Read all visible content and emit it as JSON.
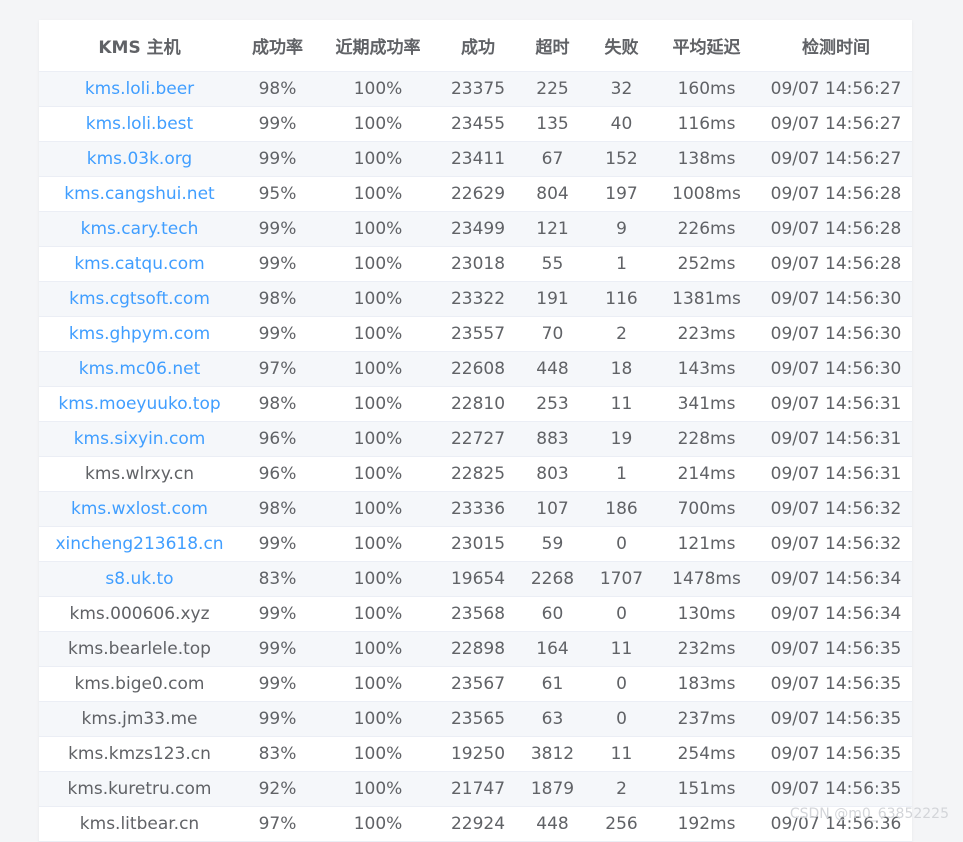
{
  "table": {
    "headers": [
      "KMS 主机",
      "成功率",
      "近期成功率",
      "成功",
      "超时",
      "失败",
      "平均延迟",
      "检测时间"
    ],
    "rows": [
      {
        "host": "kms.loli.beer",
        "link": true,
        "rate": "98%",
        "recent": "100%",
        "success": "23375",
        "timeout": "225",
        "fail": "32",
        "latency": "160ms",
        "time": "09/07 14:56:27"
      },
      {
        "host": "kms.loli.best",
        "link": true,
        "rate": "99%",
        "recent": "100%",
        "success": "23455",
        "timeout": "135",
        "fail": "40",
        "latency": "116ms",
        "time": "09/07 14:56:27"
      },
      {
        "host": "kms.03k.org",
        "link": true,
        "rate": "99%",
        "recent": "100%",
        "success": "23411",
        "timeout": "67",
        "fail": "152",
        "latency": "138ms",
        "time": "09/07 14:56:27"
      },
      {
        "host": "kms.cangshui.net",
        "link": true,
        "rate": "95%",
        "recent": "100%",
        "success": "22629",
        "timeout": "804",
        "fail": "197",
        "latency": "1008ms",
        "time": "09/07 14:56:28"
      },
      {
        "host": "kms.cary.tech",
        "link": true,
        "rate": "99%",
        "recent": "100%",
        "success": "23499",
        "timeout": "121",
        "fail": "9",
        "latency": "226ms",
        "time": "09/07 14:56:28"
      },
      {
        "host": "kms.catqu.com",
        "link": true,
        "rate": "99%",
        "recent": "100%",
        "success": "23018",
        "timeout": "55",
        "fail": "1",
        "latency": "252ms",
        "time": "09/07 14:56:28"
      },
      {
        "host": "kms.cgtsoft.com",
        "link": true,
        "rate": "98%",
        "recent": "100%",
        "success": "23322",
        "timeout": "191",
        "fail": "116",
        "latency": "1381ms",
        "time": "09/07 14:56:30"
      },
      {
        "host": "kms.ghpym.com",
        "link": true,
        "rate": "99%",
        "recent": "100%",
        "success": "23557",
        "timeout": "70",
        "fail": "2",
        "latency": "223ms",
        "time": "09/07 14:56:30"
      },
      {
        "host": "kms.mc06.net",
        "link": true,
        "rate": "97%",
        "recent": "100%",
        "success": "22608",
        "timeout": "448",
        "fail": "18",
        "latency": "143ms",
        "time": "09/07 14:56:30"
      },
      {
        "host": "kms.moeyuuko.top",
        "link": true,
        "rate": "98%",
        "recent": "100%",
        "success": "22810",
        "timeout": "253",
        "fail": "11",
        "latency": "341ms",
        "time": "09/07 14:56:31"
      },
      {
        "host": "kms.sixyin.com",
        "link": true,
        "rate": "96%",
        "recent": "100%",
        "success": "22727",
        "timeout": "883",
        "fail": "19",
        "latency": "228ms",
        "time": "09/07 14:56:31"
      },
      {
        "host": "kms.wlrxy.cn",
        "link": false,
        "rate": "96%",
        "recent": "100%",
        "success": "22825",
        "timeout": "803",
        "fail": "1",
        "latency": "214ms",
        "time": "09/07 14:56:31"
      },
      {
        "host": "kms.wxlost.com",
        "link": true,
        "rate": "98%",
        "recent": "100%",
        "success": "23336",
        "timeout": "107",
        "fail": "186",
        "latency": "700ms",
        "time": "09/07 14:56:32"
      },
      {
        "host": "xincheng213618.cn",
        "link": true,
        "rate": "99%",
        "recent": "100%",
        "success": "23015",
        "timeout": "59",
        "fail": "0",
        "latency": "121ms",
        "time": "09/07 14:56:32"
      },
      {
        "host": "s8.uk.to",
        "link": true,
        "rate": "83%",
        "recent": "100%",
        "success": "19654",
        "timeout": "2268",
        "fail": "1707",
        "latency": "1478ms",
        "time": "09/07 14:56:34"
      },
      {
        "host": "kms.000606.xyz",
        "link": false,
        "rate": "99%",
        "recent": "100%",
        "success": "23568",
        "timeout": "60",
        "fail": "0",
        "latency": "130ms",
        "time": "09/07 14:56:34"
      },
      {
        "host": "kms.bearlele.top",
        "link": false,
        "rate": "99%",
        "recent": "100%",
        "success": "22898",
        "timeout": "164",
        "fail": "11",
        "latency": "232ms",
        "time": "09/07 14:56:35"
      },
      {
        "host": "kms.bige0.com",
        "link": false,
        "rate": "99%",
        "recent": "100%",
        "success": "23567",
        "timeout": "61",
        "fail": "0",
        "latency": "183ms",
        "time": "09/07 14:56:35"
      },
      {
        "host": "kms.jm33.me",
        "link": false,
        "rate": "99%",
        "recent": "100%",
        "success": "23565",
        "timeout": "63",
        "fail": "0",
        "latency": "237ms",
        "time": "09/07 14:56:35"
      },
      {
        "host": "kms.kmzs123.cn",
        "link": false,
        "rate": "83%",
        "recent": "100%",
        "success": "19250",
        "timeout": "3812",
        "fail": "11",
        "latency": "254ms",
        "time": "09/07 14:56:35"
      },
      {
        "host": "kms.kuretru.com",
        "link": false,
        "rate": "92%",
        "recent": "100%",
        "success": "21747",
        "timeout": "1879",
        "fail": "2",
        "latency": "151ms",
        "time": "09/07 14:56:35"
      },
      {
        "host": "kms.litbear.cn",
        "link": false,
        "rate": "97%",
        "recent": "100%",
        "success": "22924",
        "timeout": "448",
        "fail": "256",
        "latency": "192ms",
        "time": "09/07 14:56:36"
      }
    ]
  },
  "watermark": "CSDN @m0_63852225",
  "colors": {
    "link": "#409eff",
    "text": "#606266",
    "stripe": "#f5f7fa",
    "border": "#ebeef5"
  }
}
